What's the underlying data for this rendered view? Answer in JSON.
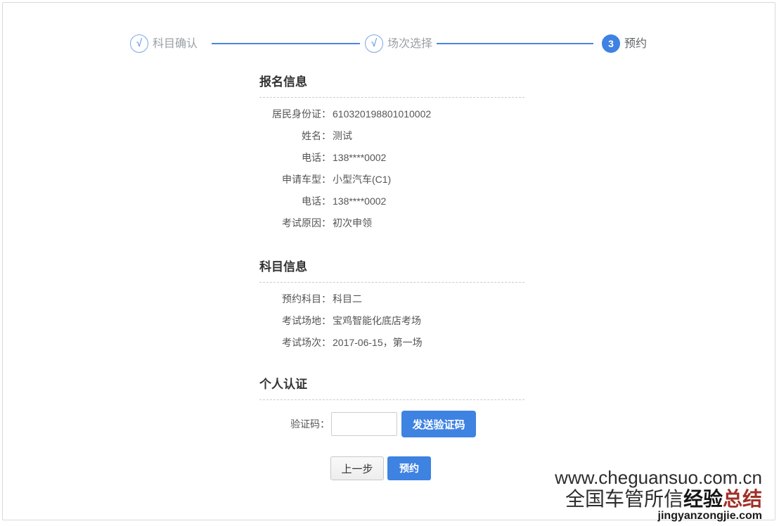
{
  "stepper": {
    "steps": [
      {
        "label": "科目确认",
        "symbol": "√",
        "state": "done"
      },
      {
        "label": "场次选择",
        "symbol": "√",
        "state": "done"
      },
      {
        "label": "预约",
        "symbol": "3",
        "state": "active"
      }
    ]
  },
  "registration": {
    "title": "报名信息",
    "fields": [
      {
        "label": "居民身份证：",
        "value": "610320198801010002"
      },
      {
        "label": "姓名：",
        "value": "测试"
      },
      {
        "label": "电话：",
        "value": "138****0002"
      },
      {
        "label": "申请车型：",
        "value": "小型汽车(C1)"
      },
      {
        "label": "电话：",
        "value": "138****0002"
      },
      {
        "label": "考试原因：",
        "value": "初次申领"
      }
    ]
  },
  "subject": {
    "title": "科目信息",
    "fields": [
      {
        "label": "预约科目：",
        "value": "科目二"
      },
      {
        "label": "考试场地：",
        "value": "宝鸡智能化底店考场"
      },
      {
        "label": "考试场次：",
        "value": "2017-06-15，第一场"
      }
    ]
  },
  "verification": {
    "title": "个人认证",
    "code_label": "验证码：",
    "code_value": "",
    "send_button_label": "发送验证码"
  },
  "actions": {
    "prev_label": "上一步",
    "submit_label": "预约"
  },
  "watermark": {
    "url_line": "www.cheguansuo.com.cn",
    "brand_prefix": "全国车管所信",
    "brand_black": "经验",
    "brand_red": "总结",
    "domain_line": "jingyanzongjie.com"
  },
  "colors": {
    "accent_blue": "#3e82e2",
    "stepper_line_blue": "#4a86e0",
    "watermark_red": "#a03028",
    "panel_border": "#d9d9d9"
  }
}
